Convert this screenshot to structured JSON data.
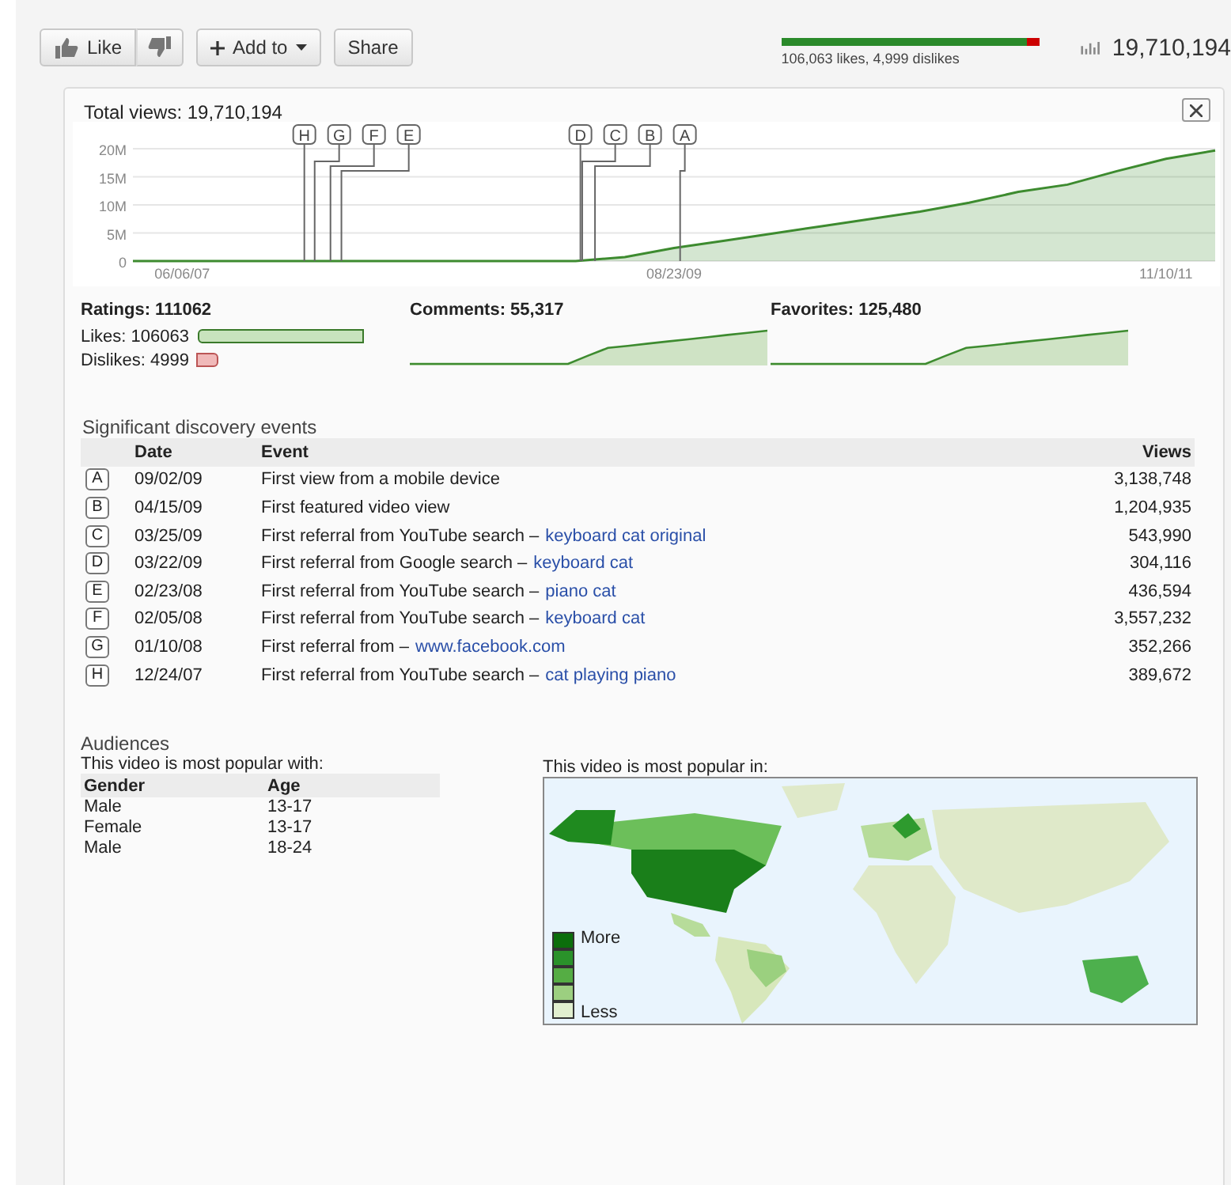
{
  "toolbar": {
    "like_button": "Like",
    "add_to_button": "Add to",
    "share_button": "Share",
    "rating_summary": {
      "level": 0.955,
      "text": "106,063 likes, 4,999 dislikes"
    },
    "view_count": "19,710,194"
  },
  "views_chart": {
    "title": "Total views: 19,710,194",
    "chart_data": {
      "type": "area",
      "categories": [
        null,
        "06/06/07",
        null,
        null,
        null,
        null,
        null,
        null,
        null,
        null,
        null,
        "08/23/09",
        null,
        null,
        null,
        null,
        null,
        null,
        null,
        null,
        null,
        "11/10/11",
        null
      ],
      "series": [
        {
          "color": "#3d8b2f",
          "values": [
            0,
            0,
            0,
            0,
            0,
            0,
            0,
            0,
            0,
            0,
            700000,
            2300000,
            3600000,
            4900000,
            6200000,
            7500000,
            8800000,
            10400000,
            12300000,
            13600000,
            16000000,
            18200000,
            19700000
          ]
        }
      ],
      "grid": true,
      "ylim": [
        0,
        20000000
      ],
      "yticks": [
        {
          "value": 0,
          "label": "0"
        },
        {
          "value": 5000000,
          "label": "5M"
        },
        {
          "value": 10000000,
          "label": "10M"
        },
        {
          "value": 15000000,
          "label": "15M"
        },
        {
          "value": 20000000,
          "label": "20M"
        }
      ],
      "annotations": [
        "A",
        "B",
        "C",
        "D",
        "E",
        "F",
        "G",
        "H"
      ]
    }
  },
  "ratings": {
    "title": "Ratings: 111062",
    "likes": {
      "label": "Likes: 106063"
    },
    "dislikes": {
      "label": "Dislikes: 4999"
    }
  },
  "comments": {
    "title": "Comments: 55,317"
  },
  "favorites": {
    "title": "Favorites: 125,480"
  },
  "events": {
    "title": "Significant discovery events",
    "columns": [
      "Date",
      "Event",
      "Views"
    ],
    "rows": [
      {
        "marker": "A",
        "date": "09/02/09",
        "event": "First view from a mobile device",
        "views": "3,138,748"
      },
      {
        "marker": "B",
        "date": "04/15/09",
        "event": "First featured video view",
        "views": "1,204,935"
      },
      {
        "marker": "C",
        "date": "03/25/09",
        "event": "First referral from YouTube search –",
        "link": "keyboard cat original",
        "views": "543,990"
      },
      {
        "marker": "D",
        "date": "03/22/09",
        "event": "First referral from Google search –",
        "link": "keyboard cat",
        "views": "304,116"
      },
      {
        "marker": "E",
        "date": "02/23/08",
        "event": "First referral from YouTube search –",
        "link": "piano cat",
        "views": "436,594"
      },
      {
        "marker": "F",
        "date": "02/05/08",
        "event": "First referral from YouTube search –",
        "link": "keyboard cat",
        "views": "3,557,232"
      },
      {
        "marker": "G",
        "date": "01/10/08",
        "event": "First referral from –",
        "link": "www.facebook.com",
        "views": "352,266"
      },
      {
        "marker": "H",
        "date": "12/24/07",
        "event": "First referral from YouTube search –",
        "link": "cat playing piano",
        "views": "389,672"
      }
    ]
  },
  "audiences": {
    "title": "Audiences",
    "subtitle": "This video is most popular with:",
    "columns": [
      "Gender",
      "Age"
    ],
    "rows": [
      [
        "Male",
        "13-17"
      ],
      [
        "Female",
        "13-17"
      ],
      [
        "Male",
        "18-24"
      ]
    ]
  },
  "map": {
    "title": "This video is most popular in:",
    "legend_more": "More",
    "legend_less": "Less"
  }
}
